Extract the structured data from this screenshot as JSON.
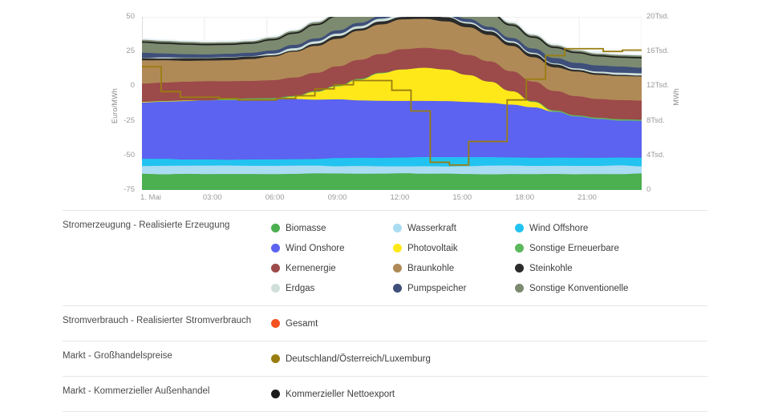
{
  "chart_data": {
    "type": "area",
    "title": "",
    "xlabel": "",
    "ylabel": "Euro/MWh",
    "y2label": "MWh",
    "ylim": [
      -75,
      50
    ],
    "y2lim": [
      0,
      20000
    ],
    "yticks_left": [
      "50",
      "25",
      "0",
      "-25",
      "-50",
      "-75"
    ],
    "yticks_right": [
      "20Tsd.",
      "16Tsd.",
      "12Tsd.",
      "8Tsd.",
      "4Tsd.",
      "0"
    ],
    "xticks": [
      "1. Mai",
      "03:00",
      "06:00",
      "09:00",
      "12:00",
      "15:00",
      "18:00",
      "21:00"
    ],
    "grid": true,
    "legend_position": "below",
    "x_hours": [
      0,
      1,
      2,
      3,
      4,
      5,
      6,
      7,
      8,
      9,
      10,
      11,
      12,
      13,
      14,
      15,
      16,
      17,
      18,
      19,
      20,
      21,
      22,
      23
    ],
    "series": [
      {
        "name": "Biomasse",
        "color": "#4caf50",
        "axis": "right",
        "values": [
          1900,
          1900,
          1900,
          1900,
          1900,
          1900,
          1900,
          1900,
          1900,
          1900,
          1900,
          1900,
          1900,
          1900,
          1900,
          1900,
          1900,
          1900,
          1900,
          1900,
          1900,
          1900,
          1900,
          1900
        ]
      },
      {
        "name": "Wasserkraft",
        "color": "#aadcf2",
        "axis": "right",
        "values": [
          900,
          900,
          900,
          900,
          900,
          900,
          900,
          900,
          900,
          900,
          900,
          900,
          900,
          900,
          900,
          900,
          900,
          900,
          900,
          900,
          900,
          900,
          900,
          900
        ]
      },
      {
        "name": "Wind Offshore",
        "color": "#22c3f0",
        "axis": "right",
        "values": [
          750,
          760,
          770,
          780,
          780,
          790,
          800,
          820,
          850,
          880,
          900,
          930,
          960,
          980,
          1000,
          1010,
          1020,
          1020,
          1010,
          1000,
          990,
          980,
          970,
          960
        ]
      },
      {
        "name": "Wind Onshore",
        "color": "#5b63f0",
        "axis": "right",
        "values": [
          6600,
          6700,
          6750,
          6800,
          6850,
          6900,
          6900,
          6850,
          6800,
          6750,
          6700,
          6650,
          6600,
          6550,
          6500,
          6400,
          6300,
          6100,
          5700,
          5200,
          4800,
          4500,
          4350,
          4300
        ]
      },
      {
        "name": "Photovoltaik",
        "color": "#ffe81a",
        "axis": "right",
        "values": [
          0,
          0,
          0,
          0,
          0,
          0,
          60,
          350,
          900,
          1600,
          2400,
          3100,
          3600,
          3800,
          3600,
          3100,
          2400,
          1500,
          700,
          150,
          0,
          0,
          0,
          0
        ]
      },
      {
        "name": "Sonstige Erneuerbare",
        "color": "#5cb85c",
        "axis": "right",
        "values": [
          60,
          60,
          60,
          60,
          60,
          60,
          60,
          60,
          60,
          60,
          60,
          60,
          60,
          60,
          60,
          60,
          60,
          60,
          60,
          60,
          60,
          60,
          60,
          60
        ]
      },
      {
        "name": "Kernenergie",
        "color": "#9c4a4a",
        "axis": "right",
        "values": [
          2100,
          2100,
          2080,
          2080,
          2080,
          2080,
          2100,
          2150,
          2200,
          2250,
          2250,
          2250,
          2250,
          2250,
          2250,
          2250,
          2250,
          2250,
          2250,
          2250,
          2250,
          2250,
          2250,
          2250
        ]
      },
      {
        "name": "Braunkohle",
        "color": "#b08a56",
        "axis": "right",
        "values": [
          2700,
          2600,
          2550,
          2500,
          2500,
          2550,
          2700,
          2900,
          3050,
          3150,
          3250,
          3350,
          3400,
          3400,
          3350,
          3250,
          3150,
          3000,
          2900,
          2800,
          2750,
          2700,
          2700,
          2700
        ]
      },
      {
        "name": "Steinkohle",
        "color": "#2b2b2b",
        "axis": "right",
        "values": [
          200,
          190,
          190,
          180,
          180,
          190,
          220,
          260,
          300,
          330,
          350,
          370,
          380,
          380,
          370,
          350,
          330,
          300,
          280,
          260,
          250,
          240,
          240,
          240
        ]
      },
      {
        "name": "Erdgas",
        "color": "#cfe0da",
        "axis": "right",
        "values": [
          150,
          150,
          150,
          150,
          150,
          150,
          160,
          180,
          200,
          220,
          230,
          240,
          250,
          250,
          240,
          230,
          220,
          200,
          190,
          180,
          175,
          170,
          170,
          170
        ]
      },
      {
        "name": "Pumpspeicher",
        "color": "#3e4f7a",
        "axis": "right",
        "values": [
          500,
          420,
          360,
          320,
          300,
          300,
          330,
          380,
          420,
          430,
          420,
          400,
          380,
          360,
          340,
          330,
          330,
          350,
          420,
          520,
          620,
          680,
          700,
          700
        ]
      },
      {
        "name": "Sonstige Konventionelle",
        "color": "#7c8a70",
        "axis": "right",
        "values": [
          1500,
          1450,
          1420,
          1400,
          1400,
          1420,
          1500,
          1650,
          1800,
          1900,
          1980,
          2030,
          2060,
          2060,
          2020,
          1950,
          1860,
          1740,
          1620,
          1520,
          1450,
          1400,
          1380,
          1370
        ]
      }
    ],
    "price_line": {
      "name": "Deutschland/Österreich/Luxemburg",
      "color": "#9a7d11",
      "axis": "left",
      "values": [
        14,
        -4,
        -8,
        -8,
        -9,
        -10,
        -10,
        -9,
        -7,
        -2,
        1,
        4,
        4,
        -3,
        -18,
        -55,
        -57,
        -40,
        -40,
        -10,
        5,
        22,
        27,
        27,
        25,
        26
      ]
    },
    "net_export_line": {
      "name": "Kommerzieller Nettoexport",
      "color": "#1a1a1a"
    },
    "consumption_line": {
      "name": "Gesamt",
      "color": "#f4511e"
    }
  },
  "axes": {
    "left_title": "Euro/MWh",
    "right_title": "MWh",
    "left_ticks": [
      "50",
      "25",
      "0",
      "-25",
      "-50",
      "-75"
    ],
    "right_ticks": [
      "20Tsd.",
      "16Tsd.",
      "12Tsd.",
      "8Tsd.",
      "4Tsd.",
      "0"
    ],
    "x_ticks": [
      "1. Mai",
      "03:00",
      "06:00",
      "09:00",
      "12:00",
      "15:00",
      "18:00",
      "21:00"
    ]
  },
  "legend": {
    "rows": [
      {
        "title": "Stromerzeugung - Realisierte Erzeugung",
        "items": [
          {
            "label": "Biomasse",
            "color": "#4caf50"
          },
          {
            "label": "Wasserkraft",
            "color": "#aadcf2"
          },
          {
            "label": "Wind Offshore",
            "color": "#22c3f0"
          },
          {
            "label": "Wind Onshore",
            "color": "#5b63f0"
          },
          {
            "label": "Photovoltaik",
            "color": "#ffe81a"
          },
          {
            "label": "Sonstige Erneuerbare",
            "color": "#5cb85c"
          },
          {
            "label": "Kernenergie",
            "color": "#9c4a4a"
          },
          {
            "label": "Braunkohle",
            "color": "#b08a56"
          },
          {
            "label": "Steinkohle",
            "color": "#2b2b2b"
          },
          {
            "label": "Erdgas",
            "color": "#cfe0da"
          },
          {
            "label": "Pumpspeicher",
            "color": "#3e4f7a"
          },
          {
            "label": "Sonstige Konventionelle",
            "color": "#7c8a70"
          }
        ]
      },
      {
        "title": "Stromverbrauch - Realisierter Stromverbrauch",
        "items": [
          {
            "label": "Gesamt",
            "color": "#f4511e"
          }
        ]
      },
      {
        "title": "Markt - Großhandelspreise",
        "items": [
          {
            "label": "Deutschland/Österreich/Luxemburg",
            "color": "#9a7d11"
          }
        ]
      },
      {
        "title": "Markt - Kommerzieller Außenhandel",
        "items": [
          {
            "label": "Kommerzieller Nettoexport",
            "color": "#1a1a1a"
          }
        ]
      }
    ]
  }
}
